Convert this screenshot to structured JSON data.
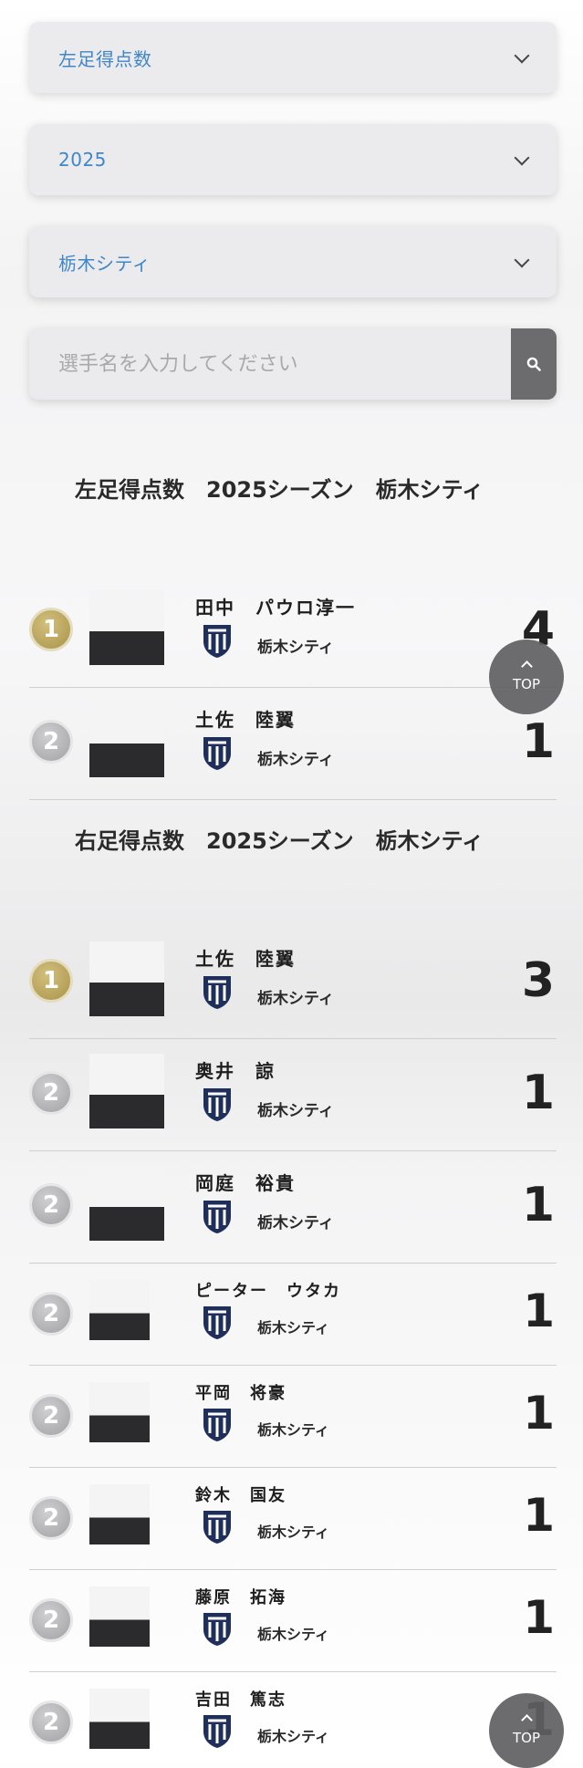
{
  "filters": {
    "category": "左足得点数",
    "season": "2025",
    "team": "栃木シティ"
  },
  "search": {
    "placeholder": "選手名を入力してください"
  },
  "sections": [
    {
      "title": "左足得点数　2025シーズン　栃木シティ",
      "rows": [
        {
          "rank": "1",
          "name": "田中　パウロ淳一",
          "team": "栃木シティ",
          "score": "4"
        },
        {
          "rank": "2",
          "name": "土佐　陸翼",
          "team": "栃木シティ",
          "score": "1"
        }
      ]
    },
    {
      "title": "右足得点数　2025シーズン　栃木シティ",
      "rows": [
        {
          "rank": "1",
          "name": "土佐　陸翼",
          "team": "栃木シティ",
          "score": "3"
        },
        {
          "rank": "2",
          "name": "奥井　諒",
          "team": "栃木シティ",
          "score": "1"
        },
        {
          "rank": "2",
          "name": "岡庭　裕貴",
          "team": "栃木シティ",
          "score": "1"
        },
        {
          "rank": "2",
          "name": "ピーター　ウタカ",
          "team": "栃木シティ",
          "score": "1"
        },
        {
          "rank": "2",
          "name": "平岡　将豪",
          "team": "栃木シティ",
          "score": "1"
        },
        {
          "rank": "2",
          "name": "鈴木　国友",
          "team": "栃木シティ",
          "score": "1"
        },
        {
          "rank": "2",
          "name": "藤原　拓海",
          "team": "栃木シティ",
          "score": "1"
        },
        {
          "rank": "2",
          "name": "吉田　篤志",
          "team": "栃木シティ",
          "score": "1"
        }
      ]
    }
  ],
  "top_button": {
    "label": "TOP"
  },
  "colors": {
    "accent": "#3f86c8",
    "gold": "#b4a055",
    "silver": "#b4b4b6",
    "emblem": "#1f2f5c"
  }
}
